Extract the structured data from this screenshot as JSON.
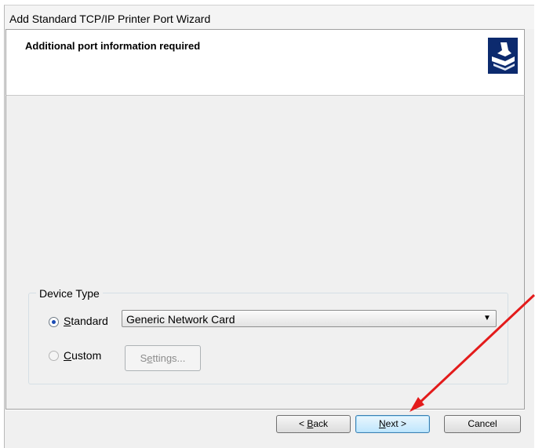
{
  "window": {
    "title": "Add Standard TCP/IP Printer Port Wizard"
  },
  "header": {
    "title": "Additional port information required",
    "icon": "printer-port-wizard-icon"
  },
  "device_type": {
    "group_label": "Device Type",
    "standard": {
      "underlined_letter": "S",
      "rest": "tandard",
      "checked": true
    },
    "standard_select_value": "Generic Network Card",
    "custom": {
      "underlined_letter": "C",
      "rest": "ustom",
      "checked": false
    },
    "settings_button": {
      "before": "S",
      "underlined_letter": "e",
      "after": "ttings..."
    }
  },
  "footer": {
    "back": {
      "before": "< ",
      "underlined_letter": "B",
      "after": "ack"
    },
    "next": {
      "underlined_letter": "N",
      "after": "ext >"
    },
    "cancel": "Cancel"
  },
  "annotation": {
    "arrow_color": "#e31b1b"
  }
}
